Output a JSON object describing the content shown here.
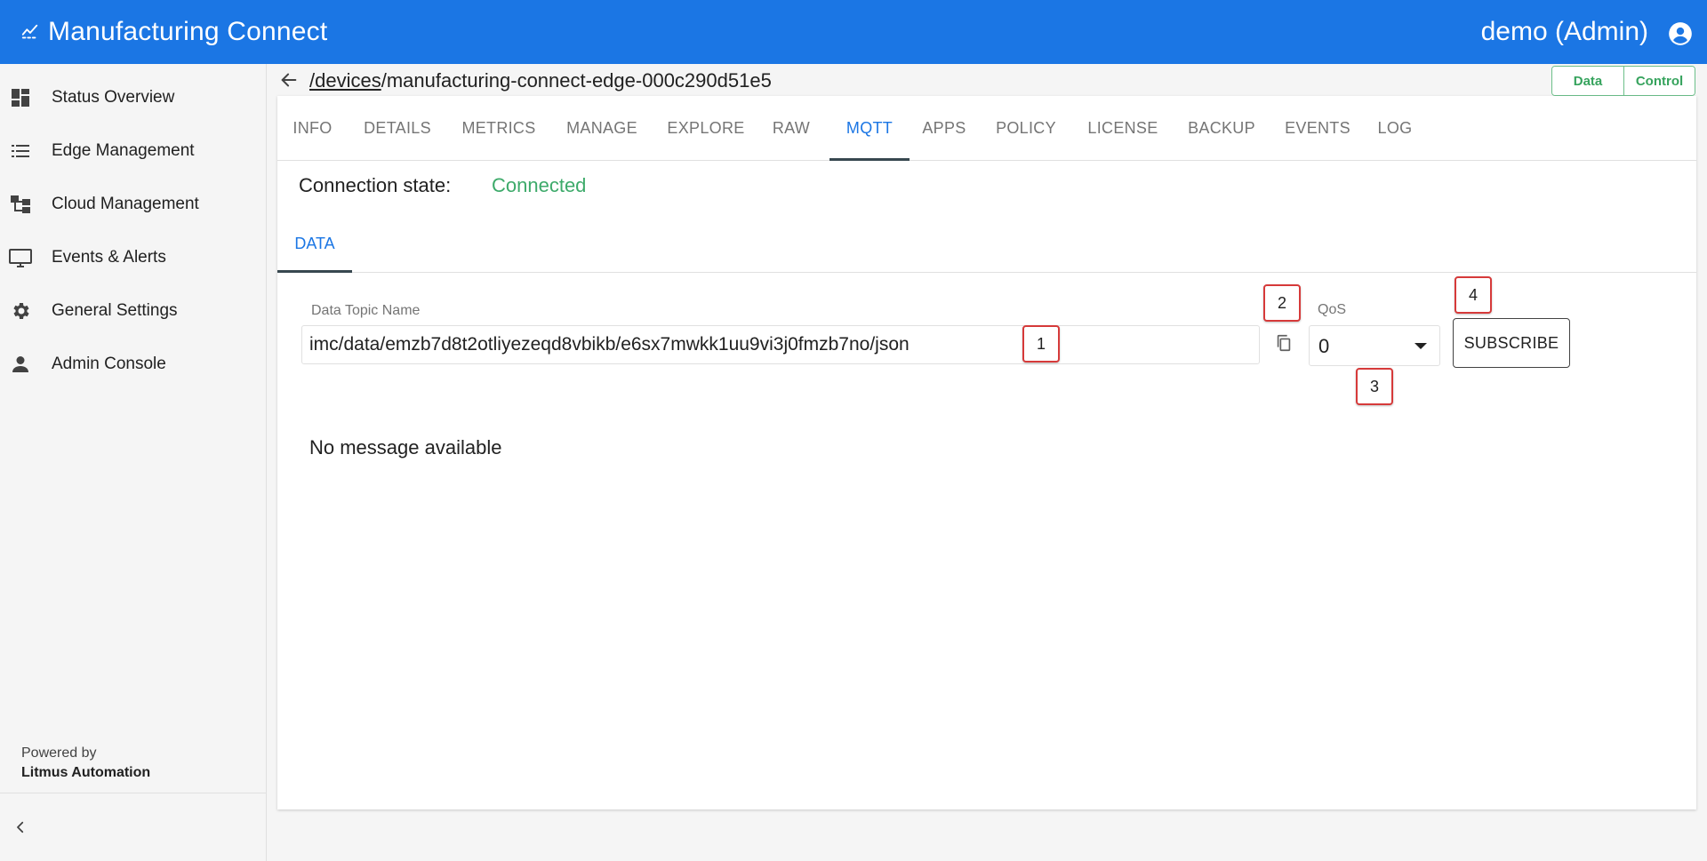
{
  "app": {
    "title": "Manufacturing Connect",
    "user": "demo (Admin)"
  },
  "sidebar": {
    "items": [
      {
        "label": "Status Overview",
        "icon": "dashboard-icon"
      },
      {
        "label": "Edge Management",
        "icon": "list-icon"
      },
      {
        "label": "Cloud Management",
        "icon": "hierarchy-icon"
      },
      {
        "label": "Events & Alerts",
        "icon": "monitor-icon"
      },
      {
        "label": "General Settings",
        "icon": "gear-icon"
      },
      {
        "label": "Admin Console",
        "icon": "person-icon"
      }
    ],
    "powered_by": "Powered by",
    "brand": "Litmus Automation"
  },
  "header": {
    "breadcrumb_link": "/devices",
    "breadcrumb_rest": "/manufacturing-connect-edge-000c290d51e5",
    "toggle_data": "Data",
    "toggle_control": "Control"
  },
  "tabs": [
    {
      "label": "INFO"
    },
    {
      "label": "DETAILS"
    },
    {
      "label": "METRICS"
    },
    {
      "label": "MANAGE"
    },
    {
      "label": "EXPLORE"
    },
    {
      "label": "RAW"
    },
    {
      "label": "MQTT"
    },
    {
      "label": "APPS"
    },
    {
      "label": "POLICY"
    },
    {
      "label": "LICENSE"
    },
    {
      "label": "BACKUP"
    },
    {
      "label": "EVENTS"
    },
    {
      "label": "LOG"
    }
  ],
  "active_tab": "MQTT",
  "connection": {
    "label": "Connection state:",
    "value": "Connected"
  },
  "subtab": {
    "label": "DATA"
  },
  "form": {
    "topic_label": "Data Topic Name",
    "topic_value": "imc/data/emzb7d8t2otliyezeqd8vbikb/e6sx7mwkk1uu9vi3j0fmzb7no/json",
    "qos_label": "QoS",
    "qos_value": "0",
    "subscribe_label": "SUBSCRIBE"
  },
  "messages": {
    "empty": "No message available"
  },
  "annotations": [
    "1",
    "2",
    "3",
    "4"
  ],
  "colors": {
    "primary": "#1b76e4",
    "connected": "#3daa6a",
    "toggle": "#36a35d",
    "annotation_border": "#d63a3a"
  }
}
